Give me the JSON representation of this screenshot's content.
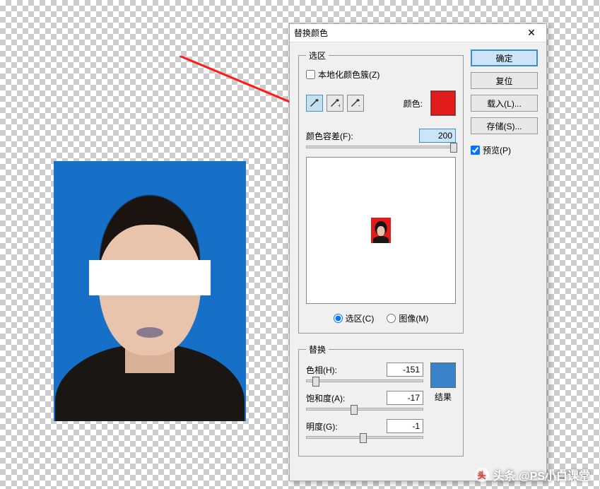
{
  "dialog": {
    "title": "替换颜色",
    "close": "✕"
  },
  "selection": {
    "legend": "选区",
    "localized_label": "本地化颜色簇(Z)",
    "color_label": "颜色:",
    "selection_color": "#e21b1b",
    "fuzziness_label": "颜色容差(F):",
    "fuzziness_value": "200",
    "radio_selection": "选区(C)",
    "radio_image": "图像(M)"
  },
  "buttons": {
    "ok": "确定",
    "reset": "复位",
    "load": "载入(L)...",
    "save": "存储(S)...",
    "preview": "预览(P)"
  },
  "replace": {
    "legend": "替换",
    "hue_label": "色相(H):",
    "hue_value": "-151",
    "sat_label": "饱和度(A):",
    "sat_value": "-17",
    "light_label": "明度(G):",
    "light_value": "-1",
    "result_label": "结果",
    "result_color": "#3b83c9"
  },
  "watermark": {
    "text": "头条 @PS小白课堂"
  }
}
